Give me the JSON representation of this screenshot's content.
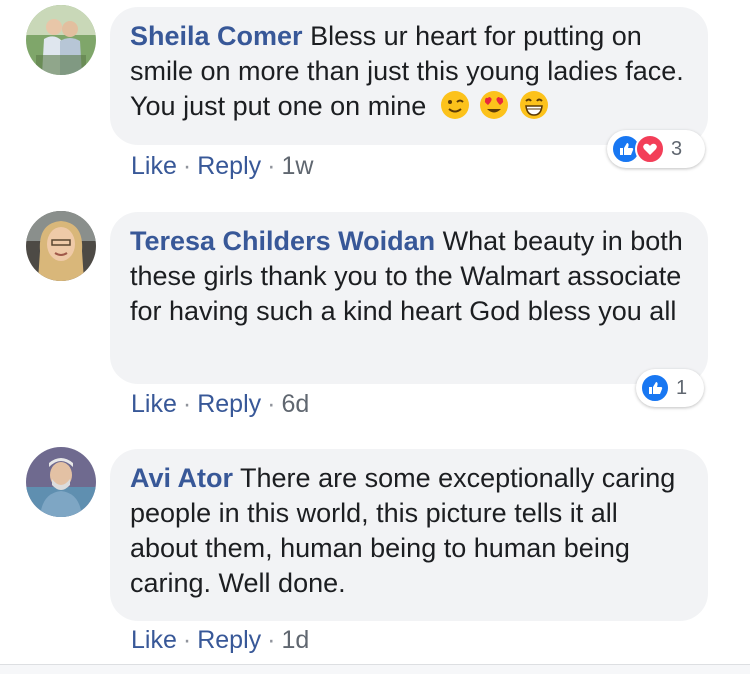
{
  "colors": {
    "author": "#385898",
    "text": "#1c1e21",
    "meta": "#606770",
    "bubble": "#f2f3f5",
    "like_blue": "#1877f2",
    "love_red": "#f33e58"
  },
  "comments": [
    {
      "author": "Sheila Comer",
      "text": "Bless ur heart for putting on smile on more than just this young ladies face. You just put one on mine",
      "emojis": [
        "wink-emoji",
        "heart-eyes-emoji",
        "grin-emoji"
      ],
      "reactions": [
        "like-icon",
        "love-icon"
      ],
      "reaction_count": "3",
      "like_label": "Like",
      "reply_label": "Reply",
      "time": "1w"
    },
    {
      "author": "Teresa Childers Woidan",
      "text": "What beauty in both these girls thank you to the Walmart associate for having such a kind heart God bless you all",
      "emojis": [],
      "reactions": [
        "like-icon"
      ],
      "reaction_count": "1",
      "like_label": "Like",
      "reply_label": "Reply",
      "time": "6d"
    },
    {
      "author": "Avi Ator",
      "text": "There are some exceptionally caring people in this world, this picture tells it all about them, human being to human being caring. Well done.",
      "emojis": [],
      "reactions": [],
      "reaction_count": "",
      "like_label": "Like",
      "reply_label": "Reply",
      "time": "1d"
    }
  ],
  "separator": "·"
}
